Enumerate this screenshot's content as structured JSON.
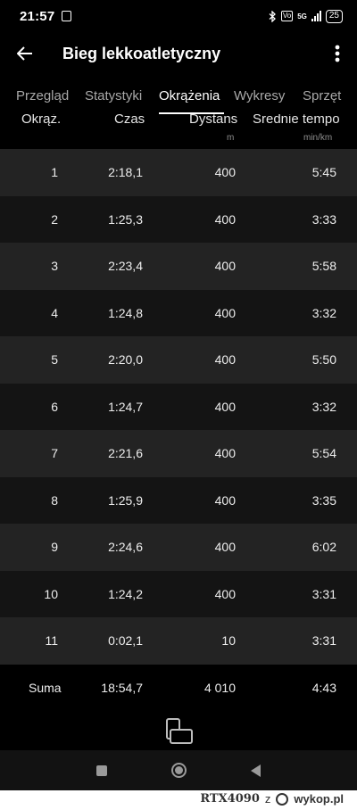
{
  "status_bar": {
    "time": "21:57",
    "network_badge": "5G",
    "volte_badge": "Vo",
    "battery": "25"
  },
  "app_bar": {
    "title": "Bieg lekkoatletyczny"
  },
  "tabs": [
    {
      "label": "Przegląd"
    },
    {
      "label": "Statystyki"
    },
    {
      "label": "Okrążenia",
      "active": true
    },
    {
      "label": "Wykresy"
    },
    {
      "label": "Sprzęt"
    }
  ],
  "table": {
    "headers": {
      "lap": "Okrąż.",
      "time": "Czas",
      "distance": "Dystans",
      "distance_unit": "m",
      "pace": "Średnie tempo",
      "pace_unit": "min/km"
    },
    "rows": [
      {
        "lap": "1",
        "time": "2:18,1",
        "distance": "400",
        "pace": "5:45"
      },
      {
        "lap": "2",
        "time": "1:25,3",
        "distance": "400",
        "pace": "3:33"
      },
      {
        "lap": "3",
        "time": "2:23,4",
        "distance": "400",
        "pace": "5:58"
      },
      {
        "lap": "4",
        "time": "1:24,8",
        "distance": "400",
        "pace": "3:32"
      },
      {
        "lap": "5",
        "time": "2:20,0",
        "distance": "400",
        "pace": "5:50"
      },
      {
        "lap": "6",
        "time": "1:24,7",
        "distance": "400",
        "pace": "3:32"
      },
      {
        "lap": "7",
        "time": "2:21,6",
        "distance": "400",
        "pace": "5:54"
      },
      {
        "lap": "8",
        "time": "1:25,9",
        "distance": "400",
        "pace": "3:35"
      },
      {
        "lap": "9",
        "time": "2:24,6",
        "distance": "400",
        "pace": "6:02"
      },
      {
        "lap": "10",
        "time": "1:24,2",
        "distance": "400",
        "pace": "3:31"
      },
      {
        "lap": "11",
        "time": "0:02,1",
        "distance": "10",
        "pace": "3:31"
      }
    ],
    "total": {
      "label": "Suma",
      "time": "18:54,7",
      "distance": "4 010",
      "pace": "4:43"
    }
  },
  "icons": {
    "back": "arrow-left-icon",
    "more": "more-vertical-icon",
    "rotate": "screen-rotate-icon"
  },
  "watermark": {
    "user": "RTX4090",
    "separator": "z",
    "domain": "wykop.pl"
  }
}
